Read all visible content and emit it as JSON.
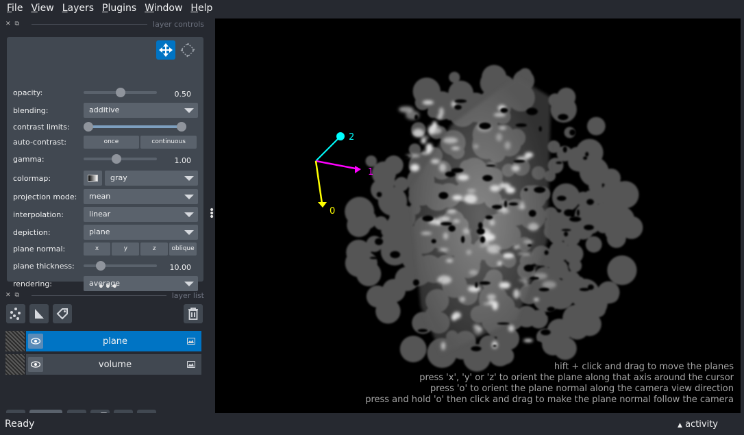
{
  "menu": [
    {
      "lead": "F",
      "rest": "ile"
    },
    {
      "lead": "V",
      "rest": "iew"
    },
    {
      "lead": "L",
      "rest": "ayers"
    },
    {
      "lead": "P",
      "rest": "lugins"
    },
    {
      "lead": "W",
      "rest": "indow"
    },
    {
      "lead": "H",
      "rest": "elp"
    }
  ],
  "layer_controls": {
    "title": "layer controls",
    "opacity": {
      "label": "opacity:",
      "value": "0.50",
      "level": 0.5
    },
    "blending": {
      "label": "blending:",
      "value": "additive"
    },
    "contrast": {
      "label": "contrast limits:",
      "low": 0.0,
      "high": 1.0
    },
    "auto_contrast": {
      "label": "auto-contrast:",
      "once": "once",
      "continuous": "continuous"
    },
    "gamma": {
      "label": "gamma:",
      "value": "1.00",
      "level": 0.45
    },
    "colormap": {
      "label": "colormap:",
      "value": "gray"
    },
    "projection": {
      "label": "projection mode:",
      "value": "mean"
    },
    "interpolation": {
      "label": "interpolation:",
      "value": "linear"
    },
    "depiction": {
      "label": "depiction:",
      "value": "plane"
    },
    "plane_normal": {
      "label": "plane normal:",
      "x": "x",
      "y": "y",
      "z": "z",
      "oblique": "oblique"
    },
    "plane_thickness": {
      "label": "plane thickness:",
      "value": "10.00",
      "level": 0.2
    },
    "rendering": {
      "label": "rendering:",
      "value": "average"
    }
  },
  "layer_list": {
    "title": "layer list",
    "layers": [
      {
        "name": "plane",
        "selected": true
      },
      {
        "name": "volume",
        "selected": false
      }
    ]
  },
  "axes": {
    "x_label": "0",
    "y_label": "1",
    "z_label": "2",
    "x_color": "#ffff00",
    "y_color": "#ff00ff",
    "z_color": "#00ffff"
  },
  "hints": [
    "hift + click and drag to move the planes",
    "press 'x', 'y' or 'z' to orient the plane along that axis around the cursor",
    "press 'o' to orient the plane normal along the camera view direction",
    "press and hold 'o' then click and drag to make the plane normal follow the camera"
  ],
  "status": {
    "text": "Ready",
    "activity": "activity"
  },
  "colors": {
    "accent": "#0074c4",
    "panel": "#414851",
    "background": "#262930"
  }
}
